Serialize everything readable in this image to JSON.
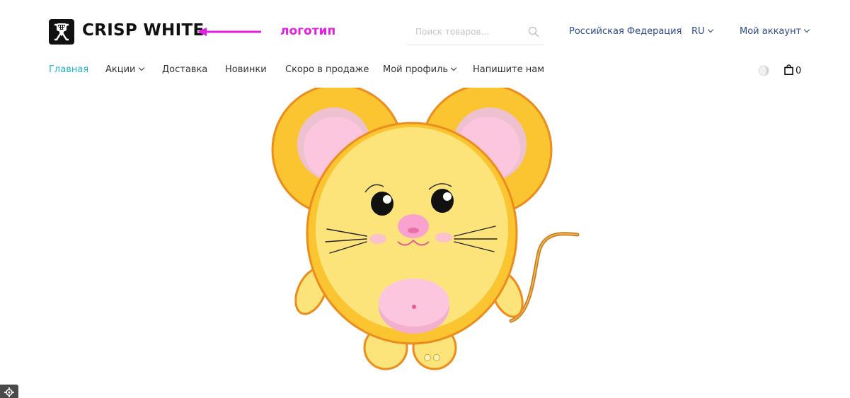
{
  "header": {
    "logo_text": "CRISP WHITE",
    "annotation_label": "логотип",
    "search_placeholder": "Поиск товаров...",
    "region": "Российская Федерация",
    "language": "RU",
    "account": "Мой аккаунт"
  },
  "nav": {
    "items": [
      {
        "label": "Главная",
        "active": true
      },
      {
        "label": "Акции",
        "has_dropdown": true
      },
      {
        "label": "Доставка"
      },
      {
        "label": "Новинки"
      },
      {
        "label": "Скоро в продаже"
      },
      {
        "label": "Мой профиль",
        "has_dropdown": true
      },
      {
        "label": "Напишите нам"
      }
    ]
  },
  "cart": {
    "count": "0"
  },
  "slider": {
    "image": "cartoon-mouse",
    "dots": 2
  },
  "colors": {
    "accent": "#1fb3c8",
    "link": "#2d4a8a",
    "annotation": "#e21ee0",
    "mouse_body": "#fde47a",
    "mouse_outline": "#ec8c1c"
  },
  "icons": [
    "logo-icon",
    "search-icon",
    "theme-toggle-icon",
    "cart-icon",
    "gear-icon"
  ]
}
